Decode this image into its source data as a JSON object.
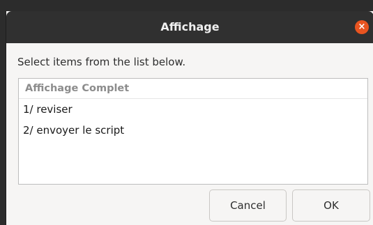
{
  "window": {
    "title": "Affichage",
    "close_glyph": "×"
  },
  "prompt": "Select items from the list below.",
  "list": {
    "header": "Affichage Complet",
    "items": [
      {
        "label": "1/ reviser"
      },
      {
        "label": "2/ envoyer le script"
      }
    ]
  },
  "buttons": {
    "cancel_label": "Cancel",
    "ok_label": "OK"
  },
  "colors": {
    "titlebar": "#303030",
    "close_button": "#e95420",
    "dialog_background": "#f6f5f4",
    "list_background": "#ffffff"
  },
  "icons": {
    "close": "close-icon"
  }
}
